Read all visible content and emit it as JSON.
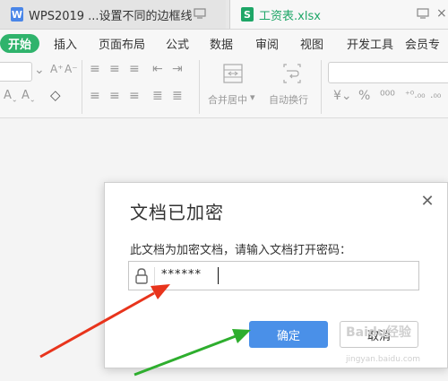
{
  "tabs": [
    {
      "icon_letter": "W",
      "title": "WPS2019 ...设置不同的边框线",
      "icon_color": "#4a86e8"
    },
    {
      "icon_letter": "S",
      "title": "工资表.xlsx",
      "icon_color": "#1ea667"
    }
  ],
  "menu": {
    "start": "开始",
    "items": [
      "插入",
      "页面布局",
      "公式",
      "数据",
      "审阅",
      "视图",
      "开发工具",
      "会员专"
    ]
  },
  "toolbar": {
    "merge_label": "合并居中",
    "wrap_label": "自动换行"
  },
  "dialog": {
    "title": "文档已加密",
    "prompt": "此文档为加密文档，请输入文档打开密码：",
    "password_value": "******",
    "ok_label": "确定",
    "cancel_label": "取消"
  },
  "watermark": {
    "text": "Baidu经验",
    "sub": "jingyan.baidu.com"
  },
  "colors": {
    "accent_green": "#2fb36c",
    "ok_blue": "#4a90e8",
    "arrow_red": "#e8341c",
    "arrow_green": "#2eae2e"
  }
}
